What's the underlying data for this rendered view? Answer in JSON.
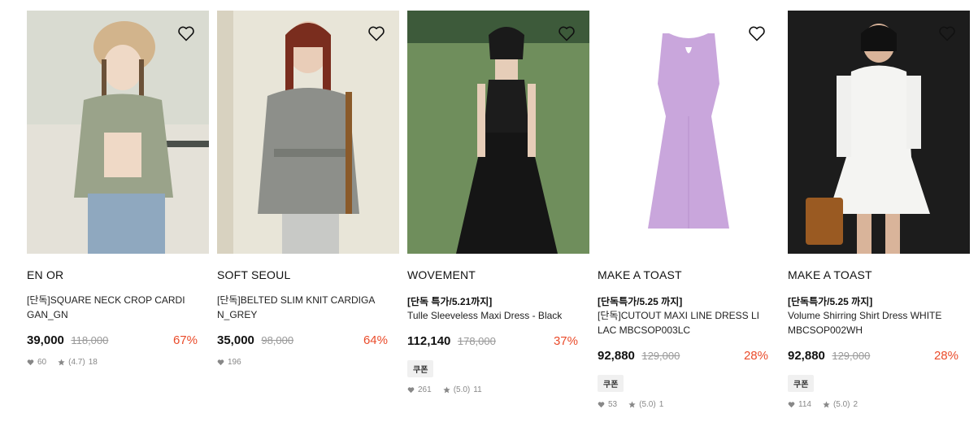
{
  "products": [
    {
      "brand": "EN OR",
      "promo": "",
      "name_lines": [
        "[단독]SQUARE NECK CROP CARDI",
        "GAN_GN"
      ],
      "price": "39,000",
      "original_price": "118,000",
      "discount": "67%",
      "coupon": "",
      "likes": "60",
      "rating": "(4.7)",
      "reviews": "18"
    },
    {
      "brand": "SOFT SEOUL",
      "promo": "",
      "name_lines": [
        "[단독]BELTED SLIM KNIT CARDIGA",
        "N_GREY"
      ],
      "price": "35,000",
      "original_price": "98,000",
      "discount": "64%",
      "coupon": "",
      "likes": "196",
      "rating": "",
      "reviews": ""
    },
    {
      "brand": "WOVEMENT",
      "promo": "[단독 특가/5.21까지]",
      "name_lines": [
        "Tulle Sleeveless Maxi Dress - Black"
      ],
      "price": "112,140",
      "original_price": "178,000",
      "discount": "37%",
      "coupon": "쿠폰",
      "likes": "261",
      "rating": "(5.0)",
      "reviews": "11"
    },
    {
      "brand": "MAKE A TOAST",
      "promo": "[단독특가/5.25 까지]",
      "name_lines": [
        "[단독]CUTOUT MAXI LINE DRESS LI",
        "LAC MBCSOP003LC"
      ],
      "price": "92,880",
      "original_price": "129,000",
      "discount": "28%",
      "coupon": "쿠폰",
      "likes": "53",
      "rating": "(5.0)",
      "reviews": "1"
    },
    {
      "brand": "MAKE A TOAST",
      "promo": "[단독특가/5.25 까지]",
      "name_lines": [
        "Volume Shirring Shirt Dress WHITE",
        "MBCSOP002WH"
      ],
      "price": "92,880",
      "original_price": "129,000",
      "discount": "28%",
      "coupon": "쿠폰",
      "likes": "114",
      "rating": "(5.0)",
      "reviews": "2"
    }
  ],
  "icons": {
    "wishlist": "heart-outline-icon",
    "likes": "heart-filled-icon",
    "rating": "star-icon"
  },
  "colors": {
    "discount": "#ea4b2a",
    "original_price": "#999999",
    "coupon_bg": "#f0f0f0"
  }
}
